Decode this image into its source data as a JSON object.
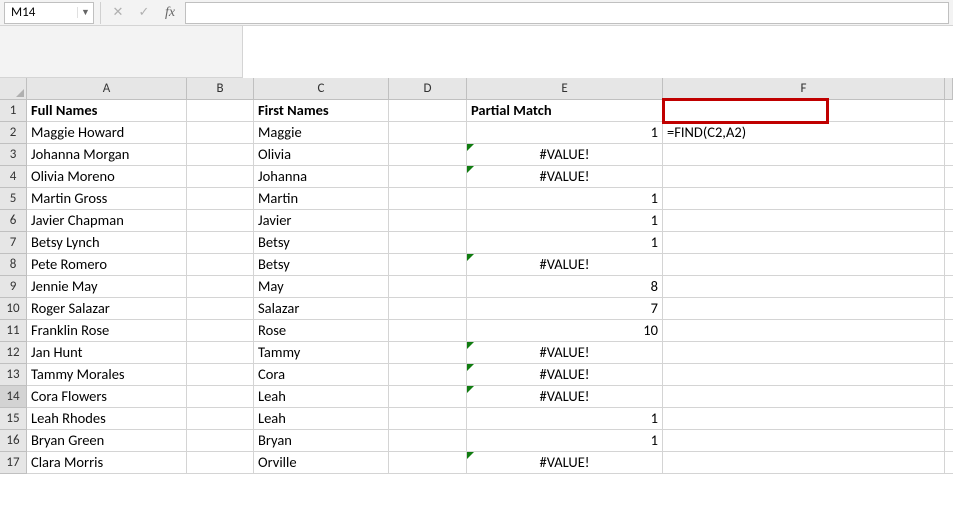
{
  "name_box": {
    "value": "M14"
  },
  "formula_input": "",
  "columns": [
    "A",
    "B",
    "C",
    "D",
    "E",
    "F",
    ""
  ],
  "rows": [
    "1",
    "2",
    "3",
    "4",
    "5",
    "6",
    "7",
    "8",
    "9",
    "10",
    "11",
    "12",
    "13",
    "14",
    "15",
    "16",
    "17"
  ],
  "headers": {
    "A": "Full Names",
    "C": "First Names",
    "E": "Partial Match"
  },
  "annotation": {
    "F2": "=FIND(C2,A2)"
  },
  "chart_data": {
    "type": "table",
    "columns": [
      "Full Names",
      "First Names",
      "Partial Match"
    ],
    "rows": [
      {
        "full": "Maggie Howard",
        "first": "Maggie",
        "match": "1",
        "err": false
      },
      {
        "full": "Johanna Morgan",
        "first": "Olivia",
        "match": "#VALUE!",
        "err": true
      },
      {
        "full": "Olivia Moreno",
        "first": "Johanna",
        "match": "#VALUE!",
        "err": true
      },
      {
        "full": "Martin Gross",
        "first": "Martin",
        "match": "1",
        "err": false
      },
      {
        "full": "Javier Chapman",
        "first": "Javier",
        "match": "1",
        "err": false
      },
      {
        "full": "Betsy Lynch",
        "first": "Betsy",
        "match": "1",
        "err": false
      },
      {
        "full": "Pete Romero",
        "first": "Betsy",
        "match": "#VALUE!",
        "err": true
      },
      {
        "full": "Jennie May",
        "first": "May",
        "match": "8",
        "err": false
      },
      {
        "full": "Roger Salazar",
        "first": "Salazar",
        "match": "7",
        "err": false
      },
      {
        "full": "Franklin Rose",
        "first": "Rose",
        "match": "10",
        "err": false
      },
      {
        "full": "Jan Hunt",
        "first": "Tammy",
        "match": "#VALUE!",
        "err": true
      },
      {
        "full": "Tammy Morales",
        "first": "Cora",
        "match": "#VALUE!",
        "err": true
      },
      {
        "full": "Cora Flowers",
        "first": "Leah",
        "match": "#VALUE!",
        "err": true
      },
      {
        "full": "Leah Rhodes",
        "first": "Leah",
        "match": "1",
        "err": false
      },
      {
        "full": "Bryan Green",
        "first": "Bryan",
        "match": "1",
        "err": false
      },
      {
        "full": "Clara Morris",
        "first": "Orville",
        "match": "#VALUE!",
        "err": true
      }
    ]
  },
  "active_row_label": "14"
}
